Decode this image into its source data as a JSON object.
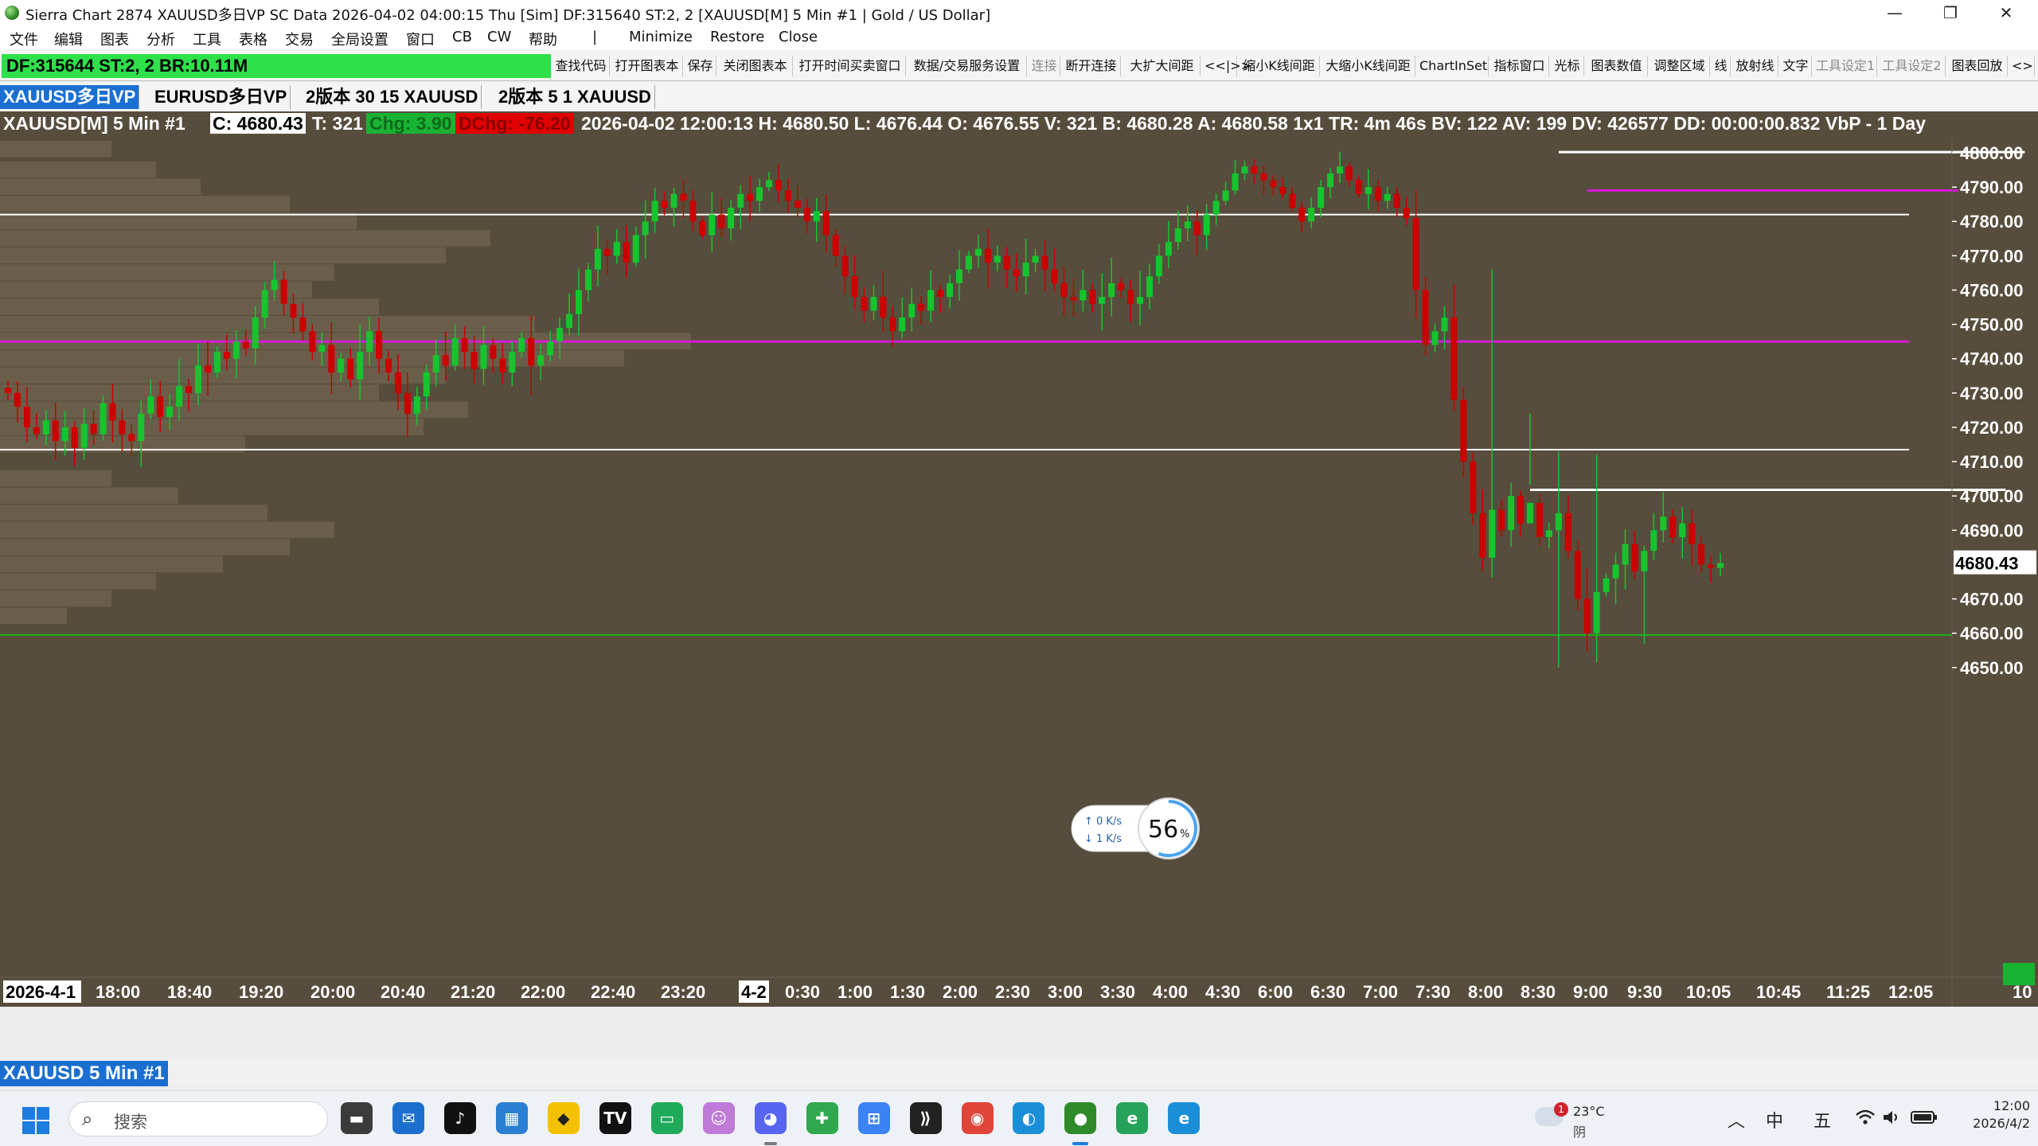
{
  "window": {
    "title": "Sierra Chart 2874 XAUUSD多日VP  SC Data 2026-04-02  04:00:15 Thu [Sim] DF:315640  ST:2, 2 [XAUUSD[M]  5 Min  #1 | Gold / US Dollar]",
    "minimize_glyph": "—",
    "restore_glyph": "❐",
    "close_glyph": "✕"
  },
  "menu": {
    "items": [
      "文件",
      "编辑",
      "图表",
      "分析",
      "工具",
      "表格",
      "交易",
      "全局设置",
      "窗口",
      "CB",
      "CW",
      "帮助",
      "|",
      "Minimize",
      "Restore",
      "Close"
    ]
  },
  "toolbar": {
    "status": "DF:315644  ST:2, 2   BR:10.11M",
    "buttons": [
      "查找代码",
      "打开图表本",
      "保存",
      "关闭图表本",
      "打开时间买卖窗口",
      "数据/交易服务设置",
      "连接",
      "断开连接",
      "大扩大间距",
      "<<|>>",
      "缩小K线间距",
      "大缩小K线间距",
      "ChartInSet",
      "指标窗口",
      "光标",
      "图表数值",
      "调整区域",
      "线",
      "放射线",
      "文字",
      "工具设定1",
      "工具设定2",
      "图表回放",
      "<>"
    ]
  },
  "tabs": [
    "XAUUSD多日VP",
    "EURUSD多日VP",
    "2版本 30 15 XAUUSD",
    "2版本 5  1 XAUUSD"
  ],
  "info": {
    "symbol": "XAUUSD[M]  5 Min  #1",
    "close": "C: 4680.43",
    "trades": "T: 321",
    "chg": "Chg: 3.90",
    "dchg": "DChg: -76.20",
    "details": "2026-04-02 12:00:13 H: 4680.50 L: 4676.44 O: 4676.55 V: 321 B: 4680.28 A: 4680.58 1x1 TR: 4m 46s BV: 122 AV: 199 DV: 426577 DD: 00:00:00.832 VbP - 1 Day"
  },
  "colors": {
    "chart_bg": "#574d3d",
    "up_candle": "#16c42e",
    "down_candle": "#cc0000",
    "profile": "#7a6d55",
    "magenta_line": "#d61ad6",
    "white_line": "#ffffff",
    "green_line": "#18b31a",
    "last_price_bg": "#ffffff",
    "countdown_bg": "#19b334"
  },
  "price_axis": {
    "labels": [
      "4800.00",
      "4790.00",
      "4780.00",
      "4770.00",
      "4760.00",
      "4750.00",
      "4740.00",
      "4730.00",
      "4720.00",
      "4710.00",
      "4700.00",
      "4690.00",
      "4680.43",
      "4670.00",
      "4660.00",
      "4650.00"
    ]
  },
  "chart_data": {
    "type": "candlestick",
    "symbol": "XAUUSD[M]",
    "interval": "5 Min",
    "ylim": [
      4647,
      4804
    ],
    "last_price": 4680.43,
    "countdown": "10",
    "x_ticks": [
      "2026-4-1",
      "18:00",
      "18:40",
      "19:20",
      "20:00",
      "20:40",
      "21:20",
      "22:00",
      "22:40",
      "23:20",
      "4-2",
      "0:30",
      "1:00",
      "1:30",
      "2:00",
      "2:30",
      "3:00",
      "3:30",
      "4:00",
      "4:30",
      "6:00",
      "6:30",
      "7:00",
      "7:30",
      "8:00",
      "8:30",
      "9:00",
      "9:30",
      "10:05",
      "10:45",
      "11:25",
      "12:05"
    ],
    "horizontal_lines": [
      {
        "price": 4782.0,
        "color": "white"
      },
      {
        "price": 4745.0,
        "color": "magenta"
      },
      {
        "price": 4713.5,
        "color": "white"
      },
      {
        "price": 4659.5,
        "color": "green"
      }
    ],
    "segments": [
      {
        "price": 4800.2,
        "from_bar": 163,
        "to_bar": 212,
        "color": "white"
      },
      {
        "price": 4789.0,
        "from_bar": 166,
        "to_bar": 205,
        "color": "magenta"
      },
      {
        "price": 4701.8,
        "from_bar": 160,
        "to_bar": 210,
        "color": "white"
      }
    ],
    "close_path": [
      4730,
      4726,
      4720,
      4718,
      4722,
      4716,
      4720,
      4714,
      4721,
      4718,
      4727,
      4722,
      4718,
      4716,
      4724,
      4729,
      4723,
      4726,
      4732,
      4730,
      4738,
      4736,
      4742,
      4740,
      4745,
      4743,
      4752,
      4760,
      4763,
      4756,
      4752,
      4748,
      4742,
      4744,
      4736,
      4740,
      4734,
      4742,
      4748,
      4740,
      4736,
      4730,
      4724,
      4729,
      4736,
      4741,
      4738,
      4746,
      4742,
      4737,
      4744,
      4740,
      4736,
      4742,
      4746,
      4738,
      4741,
      4745,
      4749,
      4753,
      4760,
      4766,
      4772,
      4770,
      4774,
      4768,
      4776,
      4780,
      4786,
      4784,
      4788,
      4786,
      4780,
      4776,
      4782,
      4778,
      4784,
      4788,
      4786,
      4790,
      4792,
      4789,
      4786,
      4784,
      4780,
      4783,
      4776,
      4770,
      4764,
      4758,
      4754,
      4758,
      4752,
      4748,
      4752,
      4756,
      4754,
      4760,
      4758,
      4762,
      4766,
      4770,
      4772,
      4768,
      4770,
      4766,
      4764,
      4768,
      4770,
      4766,
      4762,
      4758,
      4757,
      4760,
      4756,
      4758,
      4762,
      4760,
      4756,
      4758,
      4764,
      4770,
      4774,
      4778,
      4780,
      4776,
      4782,
      4786,
      4789,
      4794,
      4796,
      4794,
      4792,
      4790,
      4788,
      4784,
      4780,
      4784,
      4790,
      4794,
      4796,
      4792,
      4788,
      4790,
      4786,
      4788,
      4784,
      4781,
      4760,
      4744,
      4748,
      4752,
      4728,
      4710,
      4695,
      4682,
      4696,
      4690,
      4700,
      4692,
      4698,
      4688,
      4690,
      4695,
      4684,
      4670,
      4660,
      4672,
      4676,
      4680,
      4686,
      4678,
      4684,
      4690,
      4694,
      4688,
      4692,
      4686,
      4680,
      4679,
      4680.43
    ],
    "volume_profile_day1": [
      [
        4801,
        10
      ],
      [
        4795,
        14
      ],
      [
        4790,
        18
      ],
      [
        4785,
        26
      ],
      [
        4780,
        32
      ],
      [
        4775,
        44
      ],
      [
        4770,
        40
      ],
      [
        4765,
        30
      ],
      [
        4760,
        28
      ],
      [
        4755,
        34
      ],
      [
        4750,
        48
      ],
      [
        4745,
        62
      ],
      [
        4740,
        56
      ],
      [
        4735,
        40
      ],
      [
        4730,
        34
      ],
      [
        4725,
        42
      ],
      [
        4720,
        38
      ],
      [
        4715,
        22
      ]
    ],
    "volume_profile_day2": [
      [
        4705,
        10
      ],
      [
        4700,
        16
      ],
      [
        4695,
        24
      ],
      [
        4690,
        30
      ],
      [
        4685,
        26
      ],
      [
        4680,
        20
      ],
      [
        4675,
        14
      ],
      [
        4670,
        10
      ],
      [
        4665,
        6
      ]
    ]
  },
  "speed_widget": {
    "up_rate": "↑ 0   K/s",
    "down_rate": "↓ 1   K/s",
    "percent": "56",
    "percent_unit": "%"
  },
  "sheet_tab": "XAUUSD  5 Min  #1",
  "taskbar": {
    "search_placeholder": "搜索",
    "weather_temp": "23°C",
    "weather_desc": "阴",
    "weather_badge": "1",
    "tray_chevron": "︿",
    "ime1": "中",
    "ime2": "五",
    "clock_time": "12:00",
    "clock_date": "2026/4/2",
    "apps": [
      {
        "name": "files",
        "color": "#3b3b3b",
        "glyph": "▬"
      },
      {
        "name": "mail",
        "color": "#1c6fcf",
        "glyph": "✉"
      },
      {
        "name": "tiktok",
        "color": "#111111",
        "glyph": "♪"
      },
      {
        "name": "calendar",
        "color": "#2a7fd4",
        "glyph": "▦"
      },
      {
        "name": "binance",
        "color": "#f3c100",
        "glyph": "◆"
      },
      {
        "name": "tradingview",
        "color": "#111111",
        "glyph": "TV"
      },
      {
        "name": "chat",
        "color": "#1faa5a",
        "glyph": "▭"
      },
      {
        "name": "cat",
        "color": "#c07ad8",
        "glyph": "☺"
      },
      {
        "name": "discord",
        "color": "#5865f2",
        "glyph": "◕"
      },
      {
        "name": "plus",
        "color": "#2fa84f",
        "glyph": "✚"
      },
      {
        "name": "windows-store",
        "color": "#3b82f6",
        "glyph": "⊞"
      },
      {
        "name": "terminal",
        "color": "#222222",
        "glyph": "⟫"
      },
      {
        "name": "chrome",
        "color": "#e0453a",
        "glyph": "◉"
      },
      {
        "name": "edge",
        "color": "#1a8fd8",
        "glyph": "◐"
      },
      {
        "name": "sierra-chart",
        "color": "#2f8a2a",
        "glyph": "●"
      },
      {
        "name": "edge-dev",
        "color": "#25a35a",
        "glyph": "e"
      },
      {
        "name": "ai-browser",
        "color": "#1a8fd8",
        "glyph": "e"
      }
    ]
  }
}
